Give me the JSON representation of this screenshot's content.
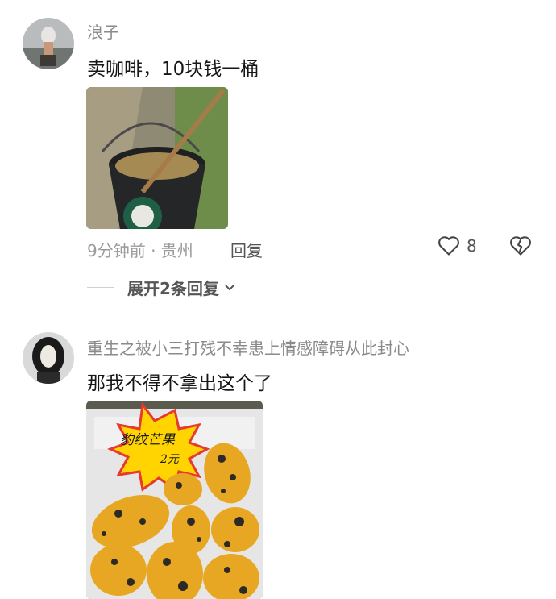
{
  "comments": [
    {
      "username": "浪子",
      "text": "卖咖啡，10块钱一桶",
      "meta": "9分钟前 · 贵州",
      "reply_label": "回复",
      "likes": "8",
      "expand_label": "展开2条回复"
    },
    {
      "username": "重生之被小三打残不幸患上情感障碍从此封心",
      "text": "那我不得不拿出这个了",
      "sign_text": "豹纹芒果",
      "sign_price": "2元"
    }
  ],
  "colors": {
    "username": "#8a8a8a",
    "meta": "#9a9a9a",
    "text": "#161616"
  }
}
